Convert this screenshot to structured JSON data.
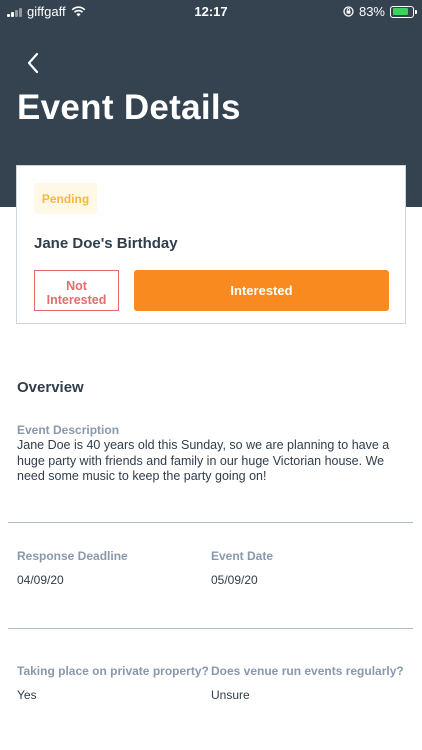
{
  "status_bar": {
    "carrier": "giffgaff",
    "time": "12:17",
    "battery": "83%",
    "battery_level": 0.83
  },
  "header": {
    "title": "Event Details"
  },
  "event": {
    "status_badge": "Pending",
    "name": "Jane Doe's Birthday",
    "not_interested_label": "Not Interested",
    "interested_label": "Interested"
  },
  "overview": {
    "title": "Overview",
    "description_label": "Event Description",
    "description": "Jane Doe is 40 years old this Sunday, so we are planning to have a huge party with friends and family in our huge Victorian house. We need some music to keep the party going on!",
    "response_deadline_label": "Response Deadline",
    "response_deadline": "04/09/20",
    "event_date_label": "Event Date",
    "event_date": "05/09/20",
    "private_property_label": "Taking place on private property?",
    "private_property": "Yes",
    "venue_regular_label": "Does venue run events regularly?",
    "venue_regular": "Unsure"
  },
  "colors": {
    "header_bg": "#35424f",
    "accent_orange": "#f88a1f",
    "pending": "#f6b83e",
    "not_interested": "#e46c6c"
  }
}
